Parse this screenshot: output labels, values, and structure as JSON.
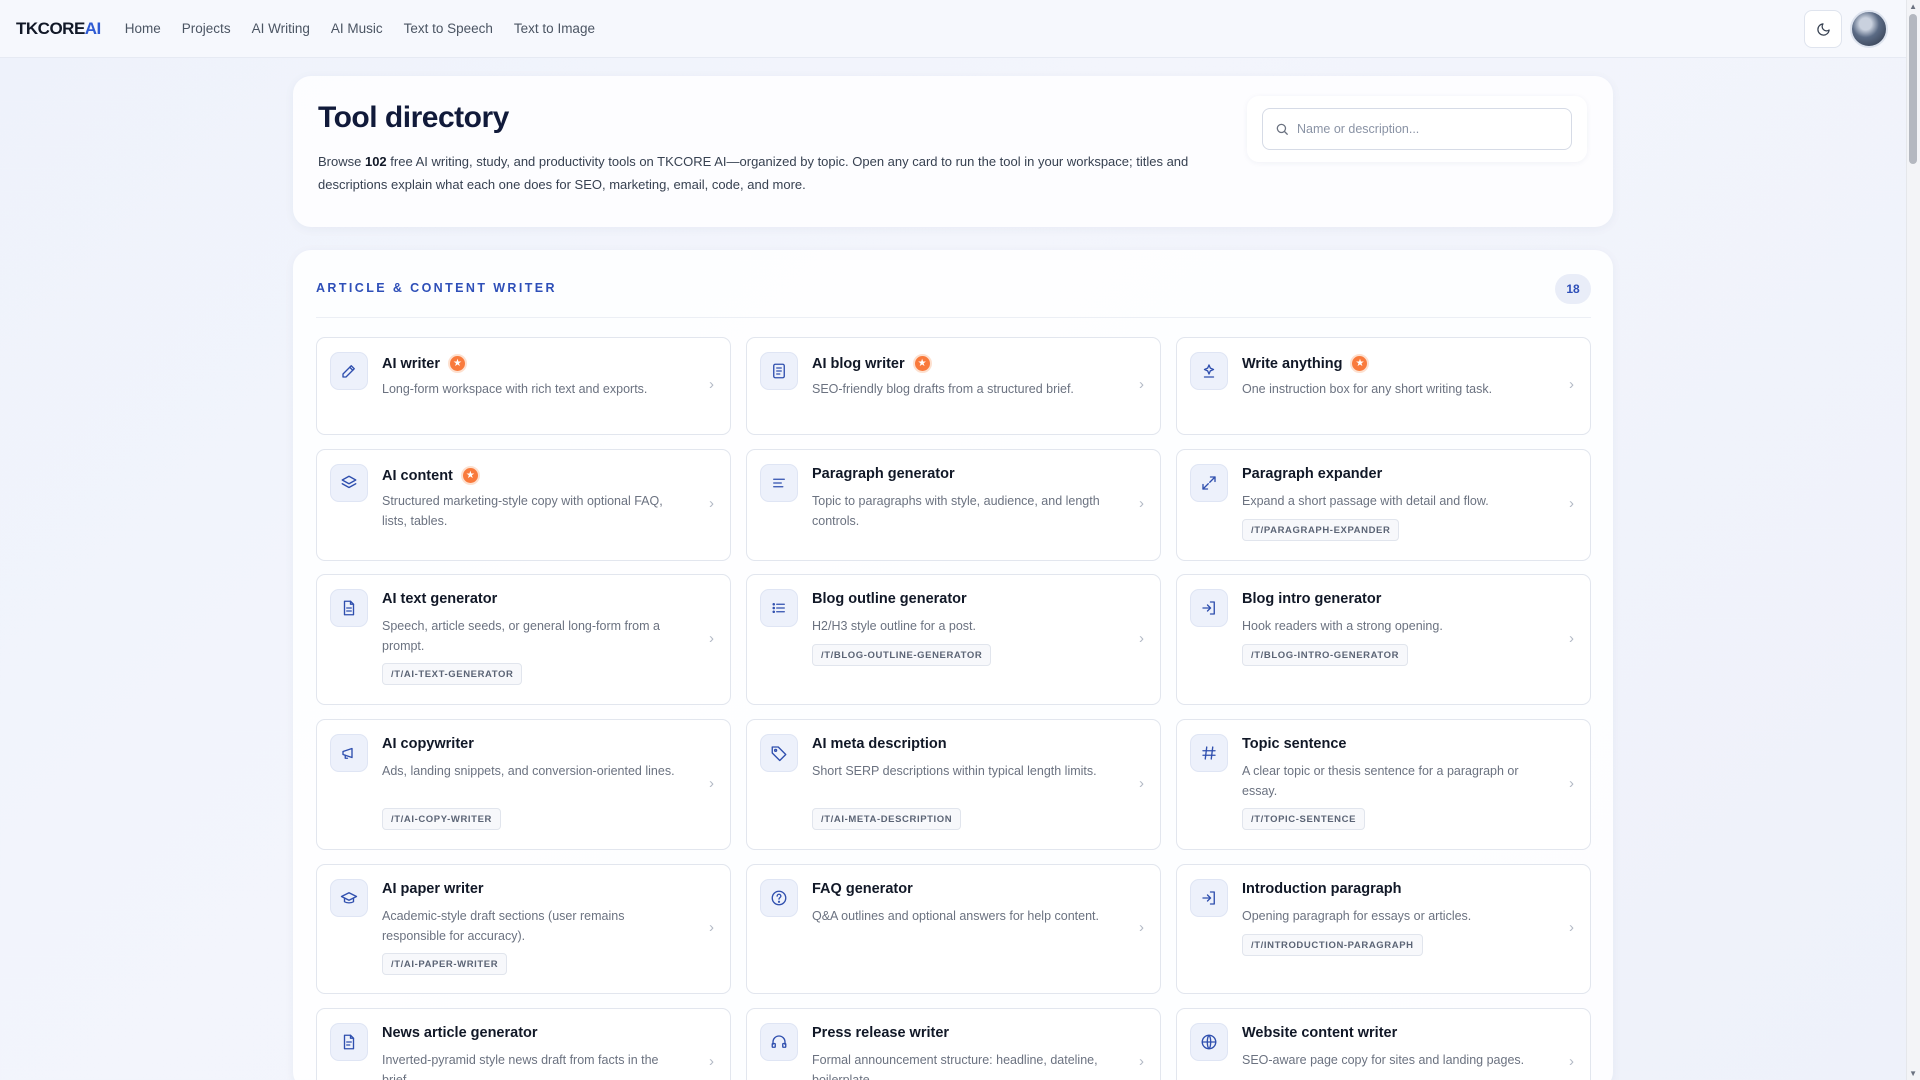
{
  "app": {
    "logo_main": "TKCORE",
    "logo_accent": "AI"
  },
  "nav": {
    "items": [
      "Home",
      "Projects",
      "AI Writing",
      "AI Music",
      "Text to Speech",
      "Text to Image"
    ]
  },
  "header": {
    "title": "Tool directory",
    "intro_prefix": "Browse ",
    "tool_count": "102",
    "intro_suffix": " free AI writing, study, and productivity tools on TKCORE AI—organized by topic. Open any card to run the tool in your workspace; titles and descriptions explain what each one does for SEO, marketing, email, code, and more.",
    "search_placeholder": "Name or description..."
  },
  "section": {
    "title": "ARTICLE & CONTENT WRITER",
    "count": "18",
    "tools": [
      {
        "name": "AI writer",
        "desc": "Long-form workspace with rich text and exports.",
        "featured": true,
        "slug": "",
        "icon": "pencil-icon"
      },
      {
        "name": "AI blog writer",
        "desc": "SEO-friendly blog drafts from a structured brief.",
        "featured": true,
        "slug": "",
        "icon": "document-icon"
      },
      {
        "name": "Write anything",
        "desc": "One instruction box for any short writing task.",
        "featured": true,
        "slug": "",
        "icon": "sparkle-icon"
      },
      {
        "name": "AI content",
        "desc": "Structured marketing-style copy with optional FAQ, lists, tables.",
        "featured": true,
        "slug": "",
        "icon": "layers-icon"
      },
      {
        "name": "Paragraph generator",
        "desc": "Topic to paragraphs with style, audience, and length controls.",
        "featured": false,
        "slug": "",
        "icon": "align-left-icon"
      },
      {
        "name": "Paragraph expander",
        "desc": "Expand a short passage with detail and flow.",
        "featured": false,
        "slug": "/T/PARAGRAPH-EXPANDER",
        "icon": "expand-icon"
      },
      {
        "name": "AI text generator",
        "desc": "Speech, article seeds, or general long-form from a prompt.",
        "featured": false,
        "slug": "/T/AI-TEXT-GENERATOR",
        "icon": "file-text-icon"
      },
      {
        "name": "Blog outline generator",
        "desc": "H2/H3 style outline for a post.",
        "featured": false,
        "slug": "/T/BLOG-OUTLINE-GENERATOR",
        "icon": "list-icon"
      },
      {
        "name": "Blog intro generator",
        "desc": "Hook readers with a strong opening.",
        "featured": false,
        "slug": "/T/BLOG-INTRO-GENERATOR",
        "icon": "login-arrow-icon"
      },
      {
        "name": "AI copywriter",
        "desc": "Ads, landing snippets, and conversion-oriented lines.",
        "featured": false,
        "slug": "/T/AI-COPY-WRITER",
        "icon": "megaphone-icon"
      },
      {
        "name": "AI meta description",
        "desc": "Short SERP descriptions within typical length limits.",
        "featured": false,
        "slug": "/T/AI-META-DESCRIPTION",
        "icon": "tag-icon"
      },
      {
        "name": "Topic sentence",
        "desc": "A clear topic or thesis sentence for a paragraph or essay.",
        "featured": false,
        "slug": "/T/TOPIC-SENTENCE",
        "icon": "hash-icon"
      },
      {
        "name": "AI paper writer",
        "desc": "Academic-style draft sections (user remains responsible for accuracy).",
        "featured": false,
        "slug": "/T/AI-PAPER-WRITER",
        "icon": "graduation-cap-icon"
      },
      {
        "name": "FAQ generator",
        "desc": "Q&A outlines and optional answers for help content.",
        "featured": false,
        "slug": "",
        "icon": "help-circle-icon"
      },
      {
        "name": "Introduction paragraph",
        "desc": "Opening paragraph for essays or articles.",
        "featured": false,
        "slug": "/T/INTRODUCTION-PARAGRAPH",
        "icon": "login-arrow-icon"
      },
      {
        "name": "News article generator",
        "desc": "Inverted-pyramid style news draft from facts in the brief.",
        "featured": false,
        "slug": "",
        "icon": "newspaper-icon"
      },
      {
        "name": "Press release writer",
        "desc": "Formal announcement structure: headline, dateline, boilerplate.",
        "featured": false,
        "slug": "",
        "icon": "headset-icon"
      },
      {
        "name": "Website content writer",
        "desc": "SEO-aware page copy for sites and landing pages.",
        "featured": false,
        "slug": "",
        "icon": "globe-icon"
      }
    ]
  }
}
